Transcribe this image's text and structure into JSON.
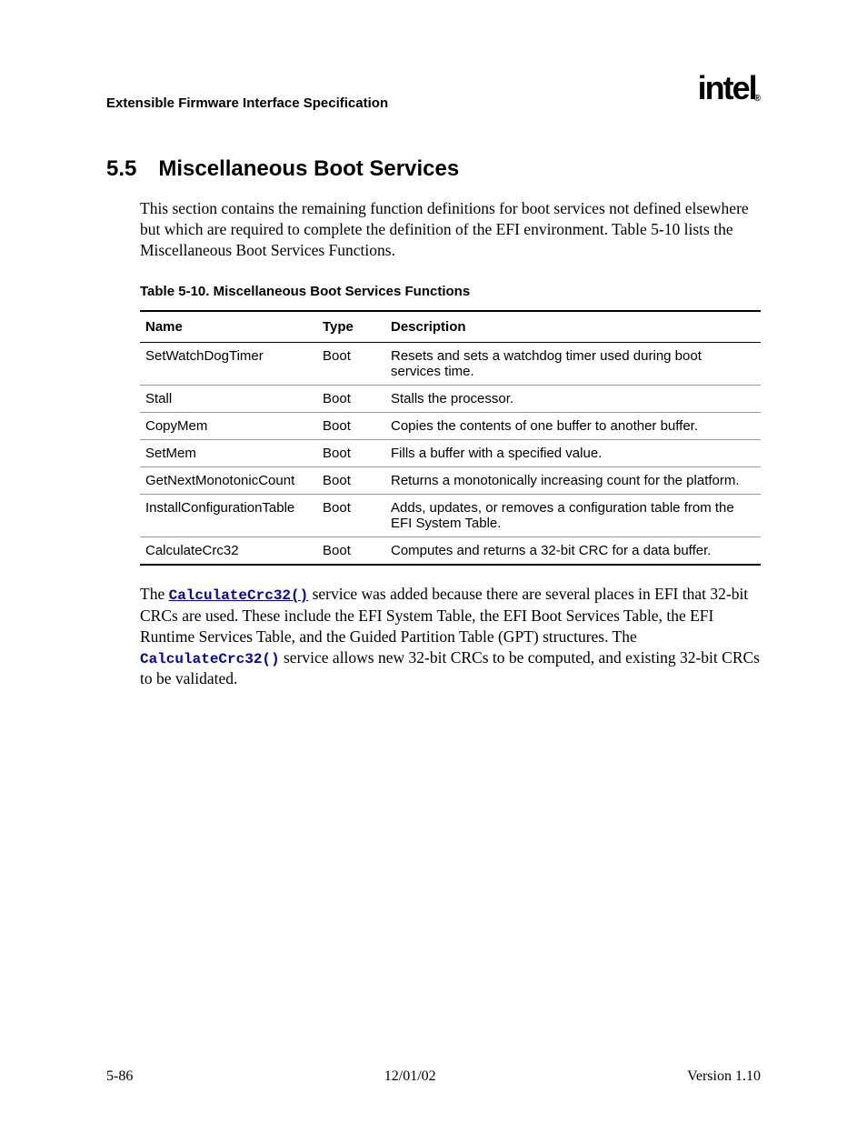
{
  "header": {
    "doc_title": "Extensible Firmware Interface Specification",
    "logo_text": "intel"
  },
  "section": {
    "number": "5.5",
    "title": "Miscellaneous Boot Services"
  },
  "intro_para": "This section contains the remaining function definitions for boot services not defined elsewhere but which are required to complete the definition of the EFI environment.  Table 5-10 lists the Miscellaneous Boot Services Functions.",
  "table": {
    "caption": "Table 5-10.   Miscellaneous Boot Services Functions",
    "headers": {
      "name": "Name",
      "type": "Type",
      "description": "Description"
    },
    "rows": [
      {
        "name": "SetWatchDogTimer",
        "type": "Boot",
        "desc": "Resets and sets a watchdog timer used during boot services time."
      },
      {
        "name": "Stall",
        "type": "Boot",
        "desc": "Stalls the processor."
      },
      {
        "name": "CopyMem",
        "type": "Boot",
        "desc": "Copies the contents of one buffer to another buffer."
      },
      {
        "name": "SetMem",
        "type": "Boot",
        "desc": "Fills a buffer with a specified value."
      },
      {
        "name": "GetNextMonotonicCount",
        "type": "Boot",
        "desc": "Returns a monotonically increasing count for the platform."
      },
      {
        "name": "InstallConfigurationTable",
        "type": "Boot",
        "desc": "Adds, updates, or removes a configuration table from the EFI System Table."
      },
      {
        "name": "CalculateCrc32",
        "type": "Boot",
        "desc": "Computes and returns a 32-bit CRC for a data buffer."
      }
    ]
  },
  "closing_para": {
    "prefix": "The ",
    "code1": "CalculateCrc32()",
    "mid": " service was added because there are several places in EFI that 32-bit CRCs are used.  These include the EFI System Table, the EFI Boot Services Table, the EFI Runtime Services Table, and the Guided Partition Table (GPT) structures.  The ",
    "code2": "CalculateCrc32()",
    "suffix": " service allows new 32-bit CRCs to be computed, and existing 32-bit CRCs to be validated."
  },
  "footer": {
    "left": "5-86",
    "center": "12/01/02",
    "right": "Version 1.10"
  }
}
